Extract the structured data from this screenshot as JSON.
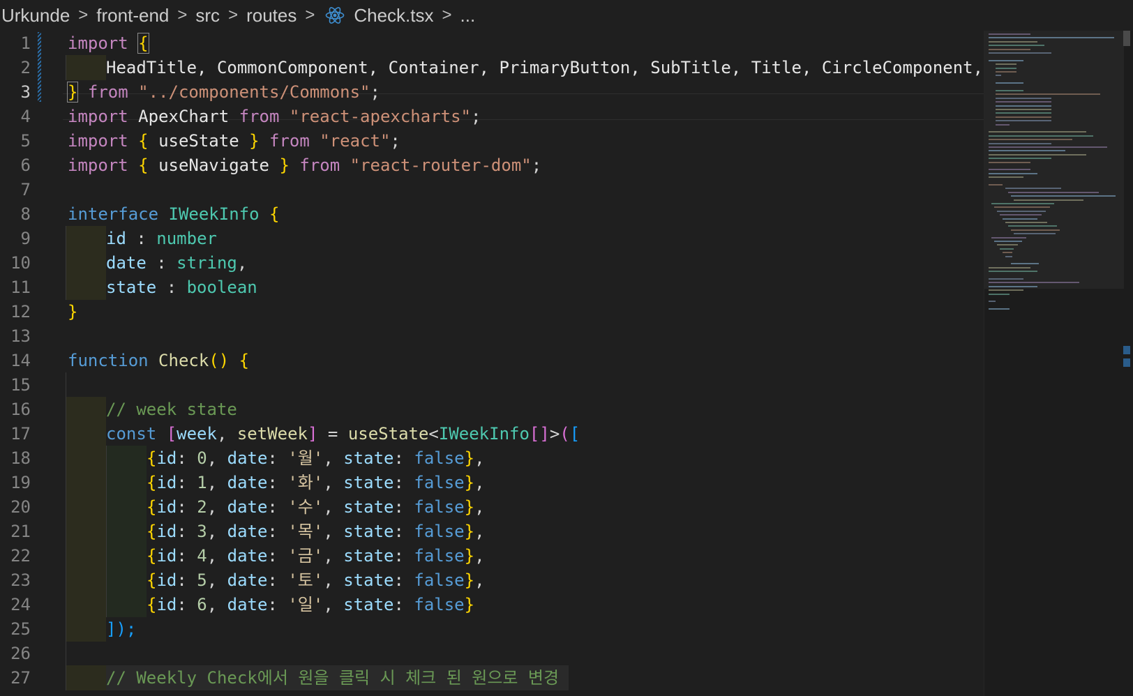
{
  "breadcrumb": {
    "items": [
      "Urkunde",
      "front-end",
      "src",
      "routes"
    ],
    "file": "Check.tsx",
    "more": "...",
    "separator": ">"
  },
  "colors": {
    "editor_bg": "#1f1f1f",
    "keyword": "#c586c0",
    "string": "#ce9178",
    "type": "#4ec9b0",
    "function": "#dcdcaa",
    "variable": "#9cdcfe",
    "comment": "#6a9955",
    "bracket_gold": "#ffd700",
    "bracket_pink": "#da70d6",
    "bracket_blue": "#179fff"
  },
  "editor": {
    "active_line": 3,
    "line_numbers": [
      "1",
      "2",
      "3",
      "4",
      "5",
      "6",
      "7",
      "8",
      "9",
      "10",
      "11",
      "12",
      "13",
      "14",
      "15",
      "16",
      "17",
      "18",
      "19",
      "20",
      "21",
      "22",
      "23",
      "24",
      "25",
      "26",
      "27"
    ],
    "t": {
      "import": "import",
      "from": "from",
      "interface": "interface",
      "function": "function",
      "const": "const",
      "lbrace": "{",
      "rbrace": "}",
      "names_l2": "HeadTitle, CommonComponent, Container, PrimaryButton, SubTitle, Title, CircleComponent,",
      "commons_path": "\"../components/Commons\"",
      "semi": ";",
      "apex": "ApexChart",
      "apex_path": "\"react-apexcharts\"",
      "useState": "useState",
      "react_path": "\"react\"",
      "useNavigate": "useNavigate",
      "router_path": "\"react-router-dom\"",
      "IWeekInfo": "IWeekInfo",
      "id": "id",
      "date": "date",
      "state": "state",
      "colon": " : ",
      "number": "number",
      "string": "string",
      "boolean": "boolean",
      "comma": ",",
      "Check": "Check",
      "parens": "()",
      "comment_week": "// week state",
      "lbracket": "[",
      "rbracket": "]",
      "week": "week",
      "setWeek": "setWeek",
      "eq": " = ",
      "lt": "<",
      "gt": ">",
      "arr": "[]",
      "lparen": "(",
      "rparen": ")",
      "id_key": "id",
      "date_key": "date",
      "state_key": "state",
      "false": "false",
      "close_call": "]);",
      "comment_weekly": "// Weekly Check에서 원을 클릭 시 체크 된 원으로 변경"
    },
    "week_rows": [
      {
        "id": "0",
        "date": "'월'"
      },
      {
        "id": "1",
        "date": "'화'"
      },
      {
        "id": "2",
        "date": "'수'"
      },
      {
        "id": "3",
        "date": "'목'"
      },
      {
        "id": "4",
        "date": "'금'"
      },
      {
        "id": "5",
        "date": "'토'"
      },
      {
        "id": "6",
        "date": "'일'"
      }
    ]
  },
  "icons": {
    "breadcrumb_file_icon": "react-icon",
    "breadcrumb_separator_icon": "chevron-right-icon"
  }
}
